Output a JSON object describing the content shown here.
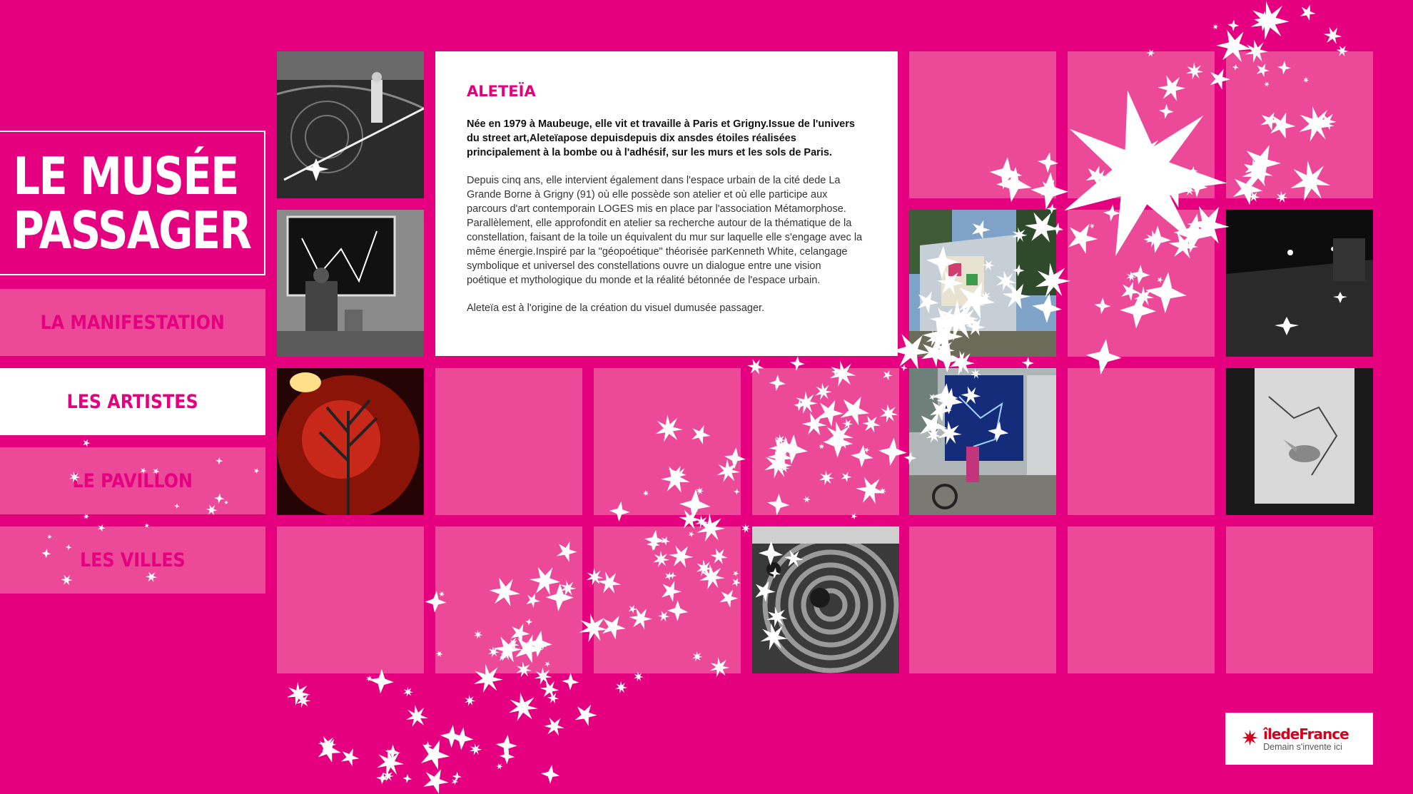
{
  "site": {
    "title_line1": "LE MUSÉE",
    "title_line2": "PASSAGER"
  },
  "nav": {
    "items": [
      {
        "label": "LA MANIFESTATION"
      },
      {
        "label": "LES ARTISTES"
      },
      {
        "label": "LE PAVILLON"
      },
      {
        "label": "LES VILLES"
      }
    ]
  },
  "artist": {
    "name": "ALETEÏA",
    "intro": "Née en 1979 à Maubeuge, elle vit et travaille à Paris et Grigny.Issue de l'univers du street art,Aleteïapose depuisdepuis dix ansdes étoiles réalisées principalement à la bombe ou à l'adhésif, sur les murs et les sols de Paris.",
    "body": "Depuis cinq ans, elle intervient également dans l'espace urbain de la cité dede La Grande Borne à Grigny (91) où elle possède son atelier et où elle participe aux parcours d'art contemporain LOGES mis en place par l'association Métamorphose. Parallèlement, elle approfondit en atelier sa recherche autour de la thématique de la constellation, faisant de la toile un équivalent du mur sur laquelle elle s'engage avec la même énergie.Inspiré par la \"géopoétique\" théorisée parKenneth White, celangage symbolique et universel des constellations ouvre un dialogue entre une vision poétique et mythologique du monde et la réalité bétonnée de l'espace urbain.",
    "credit": "Aleteïa est à l'origine de la création du visuel dumusée passager."
  },
  "logo": {
    "brand_main": "îlede",
    "brand_de": "",
    "brand_end": "France",
    "tagline": "Demain s'invente ici"
  },
  "colors": {
    "background": "#e4007e",
    "tile": "#ec4a98",
    "accent": "#e4007e",
    "logo_red": "#d6001c"
  }
}
